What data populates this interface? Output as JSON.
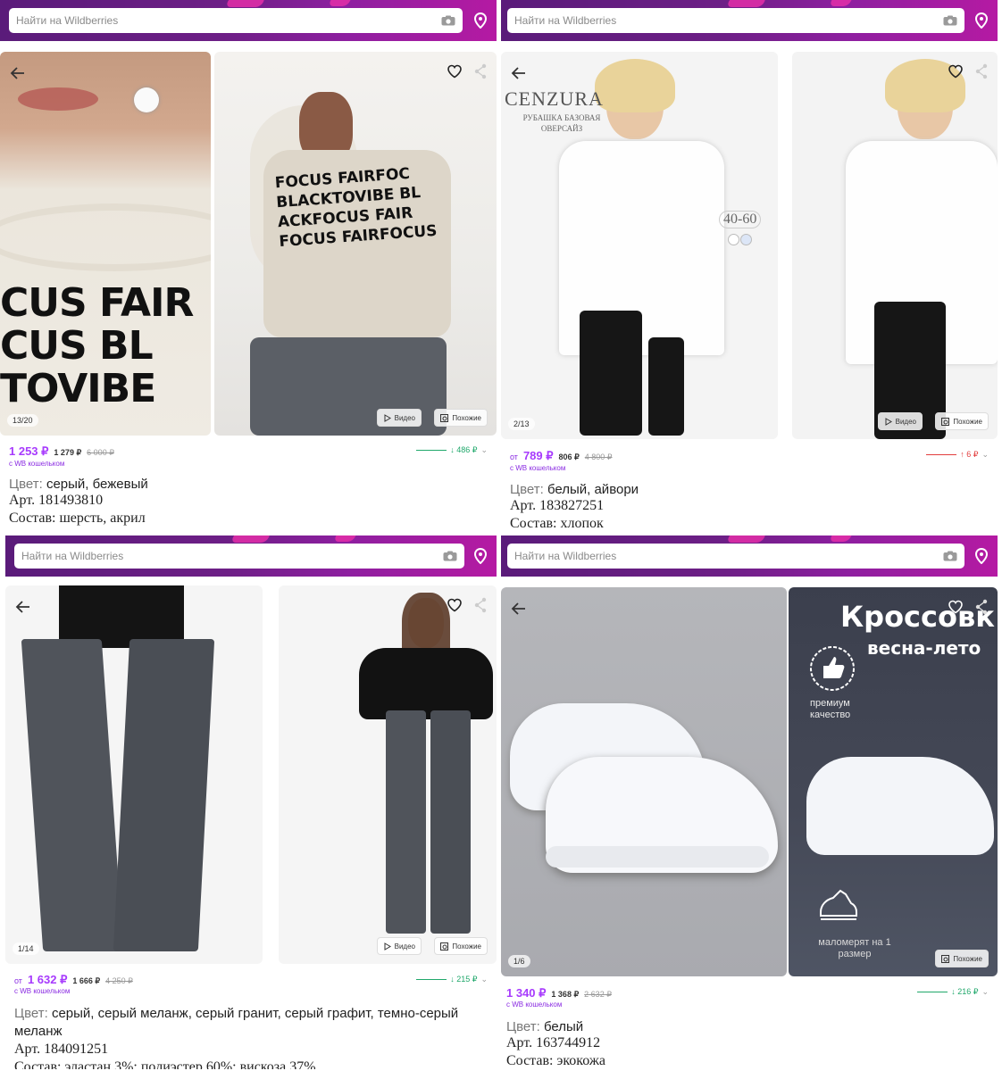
{
  "search": {
    "placeholder": "Найти на Wildberries"
  },
  "labels": {
    "video": "Видео",
    "similar": "Похожие",
    "wallet_note": "с WB кошельком",
    "color": "Цвет:",
    "from": "от"
  },
  "products": [
    {
      "counter": "13/20",
      "price_prefix": "",
      "price": "1 253 ₽",
      "price_wallet": "1 279 ₽",
      "price_old": "6 000 ₽",
      "trend": "↓ 486 ₽",
      "trend_dir": "down",
      "color": "серый, бежевый",
      "article": "Арт. 181493810",
      "composition": "Состав: шерсть, акрил",
      "sweater_text_big": "CUS FAIR\nCUS BL\nTOVIBE",
      "sweater_text_small": "FOCUS FAIRFOC\nBLACKTOVIBE BL\nACKFOCUS FAIR\nFOCUS FAIRFOCUS"
    },
    {
      "counter": "2/13",
      "price_prefix": "от",
      "price": "789 ₽",
      "price_wallet": "806 ₽",
      "price_old": "4 800 ₽",
      "trend": "↑ 6 ₽",
      "trend_dir": "up",
      "color": "белый, айвори",
      "article": "Арт. 183827251",
      "composition": "Состав: хлопок",
      "brand": "CENZURA",
      "brand_sub": "РУБАШКА БАЗОВАЯ\nОВЕРСАЙЗ",
      "size_range": "40-60"
    },
    {
      "counter": "1/14",
      "price_prefix": "от",
      "price": "1 632 ₽",
      "price_wallet": "1 666 ₽",
      "price_old": "4 250 ₽",
      "trend": "↓ 215 ₽",
      "trend_dir": "down",
      "color": "серый, серый меланж, серый гранит, серый графит, темно-серый меланж",
      "article": "Арт. 184091251",
      "composition": "Состав: эластан 3%; полиэстер 60%; вискоза 37%"
    },
    {
      "counter": "1/6",
      "price_prefix": "",
      "price": "1 340 ₽",
      "price_wallet": "1 368 ₽",
      "price_old": "2 632 ₽",
      "trend": "↓ 216 ₽",
      "trend_dir": "down",
      "color": "белый",
      "article": "Арт. 163744912",
      "composition": "Состав: экокожа",
      "banner_title": "Кроссовк",
      "banner_sub": "весна-лето",
      "badge_quality": "премиум\nкачество",
      "badge_size": "маломерят на 1\nразмер"
    }
  ]
}
